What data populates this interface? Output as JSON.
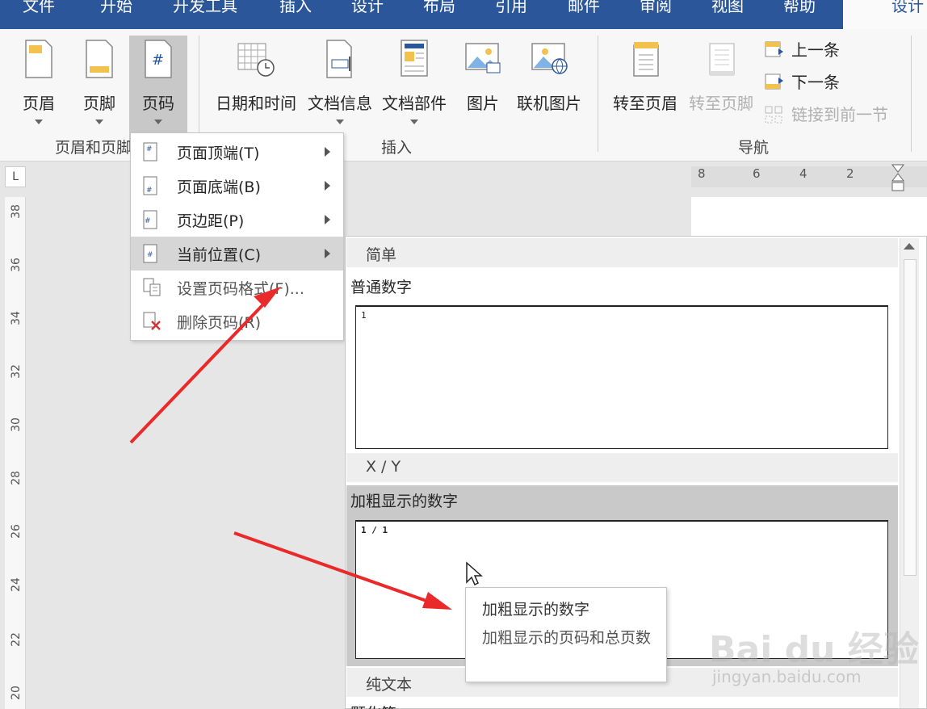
{
  "tabs": [
    "文件",
    "开始",
    "开发工具",
    "插入",
    "设计",
    "布局",
    "引用",
    "邮件",
    "审阅",
    "视图",
    "帮助",
    "设计"
  ],
  "ribbon": {
    "header_footer_group": {
      "label": "页眉和页脚",
      "buttons": [
        {
          "label": "页眉",
          "icon": "header-icon"
        },
        {
          "label": "页脚",
          "icon": "footer-icon"
        },
        {
          "label": "页码",
          "icon": "page-number-icon"
        }
      ]
    },
    "insert_group": {
      "label": "插入",
      "buttons": [
        {
          "label": "日期和时间",
          "icon": "date-time-icon"
        },
        {
          "label": "文档信息",
          "icon": "document-info-icon"
        },
        {
          "label": "文档部件",
          "icon": "quick-parts-icon"
        },
        {
          "label": "图片",
          "icon": "picture-icon"
        },
        {
          "label": "联机图片",
          "icon": "online-picture-icon"
        }
      ]
    },
    "nav_group": {
      "label": "导航",
      "goto_header": "转至页眉",
      "goto_footer": "转至页脚",
      "previous": "上一条",
      "next": "下一条",
      "link_previous": "链接到前一节"
    }
  },
  "page_number_menu": {
    "items": [
      {
        "label": "页面顶端(T)",
        "has_submenu": true,
        "icon": "page-top-icon"
      },
      {
        "label": "页面底端(B)",
        "has_submenu": true,
        "icon": "page-bottom-icon"
      },
      {
        "label": "页边距(P)",
        "has_submenu": true,
        "icon": "page-margin-icon"
      },
      {
        "label": "当前位置(C)",
        "has_submenu": true,
        "icon": "current-position-icon"
      },
      {
        "label": "设置页码格式(F)...",
        "has_submenu": false,
        "icon": "format-page-number-icon"
      },
      {
        "label": "删除页码(R)",
        "has_submenu": false,
        "icon": "remove-page-number-icon"
      }
    ]
  },
  "gallery": {
    "sections": [
      {
        "header": "简单",
        "item_title": "普通数字",
        "sample": "1"
      },
      {
        "header": "X / Y",
        "item_title": "加粗显示的数字",
        "sample": "1 / 1"
      },
      {
        "header": "纯文本",
        "item_title": "颗化符"
      }
    ]
  },
  "tooltip": {
    "title": "加粗显示的数字",
    "description": "加粗显示的页码和总页数"
  },
  "ruler": {
    "horizontal": [
      "8",
      "6",
      "4",
      "2"
    ],
    "vertical": [
      "38",
      "36",
      "34",
      "32",
      "30",
      "28",
      "26",
      "24",
      "22",
      "20"
    ],
    "corner": "L"
  },
  "watermark": {
    "brand": "Bai du 经验",
    "url": "jingyan.baidu.com"
  }
}
